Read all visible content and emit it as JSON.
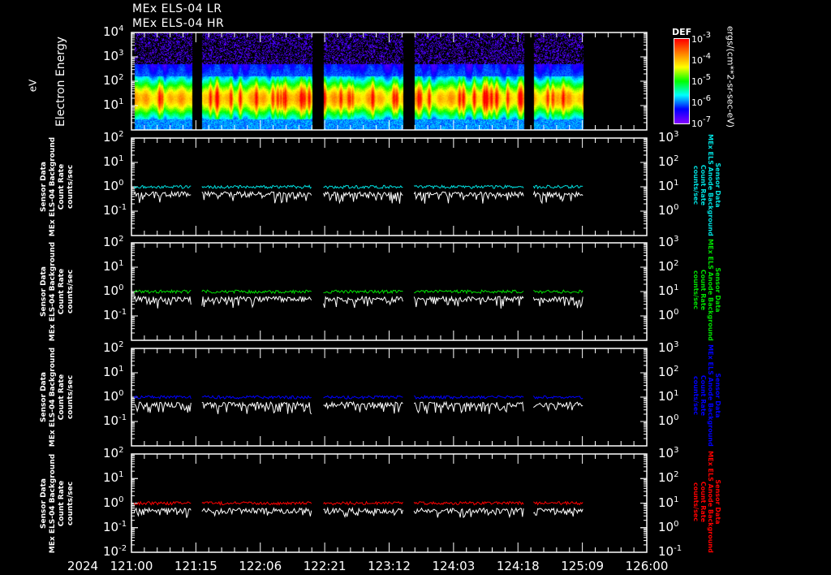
{
  "titles": [
    "MEx ELS-04 LR",
    "MEx ELS-04 HR"
  ],
  "x_axis": {
    "year": "2024",
    "tick_labels": [
      "121:00",
      "121:15",
      "122:06",
      "122:21",
      "123:12",
      "124:03",
      "124:18",
      "125:09",
      "126:00"
    ]
  },
  "colorbar": {
    "title": "DEF",
    "unit_label": "ergs/(cm**2-sr-sec-eV)",
    "tick_exponents": [
      "-3",
      "-4",
      "-5",
      "-6",
      "-7"
    ],
    "colors": [
      "#ff0000",
      "#ff8000",
      "#ffff00",
      "#00ff00",
      "#00ffff",
      "#0000ff",
      "#8000ff"
    ]
  },
  "chart_data": [
    {
      "type": "heatmap",
      "title": "MEx ELS-04 LR / HR",
      "ylabel": "Electron Energy",
      "yunit": "eV",
      "yscale": "log",
      "ylim_exponents": [
        0,
        4
      ],
      "ytick_exponents": [
        "4",
        "3",
        "2",
        "1"
      ],
      "xlim_hours": [
        0,
        120
      ],
      "data_segments_hours": [
        [
          0.6,
          14.0
        ],
        [
          16.4,
          42.1
        ],
        [
          44.7,
          63.2
        ],
        [
          65.8,
          91.3
        ],
        [
          93.6,
          105.1
        ]
      ],
      "peak_energy_eV": 20,
      "upper_cutoff_eV": 500
    },
    {
      "type": "line",
      "left_label": [
        "Sensor Data",
        "MEx ELS-04 Background",
        "Count Rate",
        "counts/sec"
      ],
      "right_label": [
        "Sensor Data",
        "MEx ELS Anode Background",
        "Count Rate",
        "counts/sec"
      ],
      "left_ytick_exponents": [
        "2",
        "1",
        "0",
        "-1"
      ],
      "right_ytick_exponents": [
        "3",
        "2",
        "1",
        "0"
      ],
      "yscale": "log",
      "series": [
        {
          "name": "ELS-04 background",
          "color": "#ffffff",
          "typical": 0.5,
          "min": 0.2
        },
        {
          "name": "Anode background",
          "color": "#00e0e0",
          "typical": 1.0,
          "min": 0.8
        }
      ]
    },
    {
      "type": "line",
      "left_label": [
        "Sensor Data",
        "MEx ELS-04 Background",
        "Count Rate",
        "counts/sec"
      ],
      "right_label": [
        "Sensor Data",
        "MEx ELS Anode Background",
        "Count Rate",
        "counts/sec"
      ],
      "left_ytick_exponents": [
        "2",
        "1",
        "0",
        "-1"
      ],
      "right_ytick_exponents": [
        "3",
        "2",
        "1",
        "0"
      ],
      "yscale": "log",
      "series": [
        {
          "name": "ELS-04 background",
          "color": "#ffffff",
          "typical": 0.5,
          "min": 0.2
        },
        {
          "name": "Anode background",
          "color": "#00e000",
          "typical": 1.0,
          "min": 0.8
        }
      ]
    },
    {
      "type": "line",
      "left_label": [
        "Sensor Data",
        "MEx ELS-04 Background",
        "Count Rate",
        "counts/sec"
      ],
      "right_label": [
        "Sensor Data",
        "MEx ELS Anode Background",
        "Count Rate",
        "counts/sec"
      ],
      "left_ytick_exponents": [
        "2",
        "1",
        "0",
        "-1"
      ],
      "right_ytick_exponents": [
        "3",
        "2",
        "1",
        "0"
      ],
      "yscale": "log",
      "series": [
        {
          "name": "ELS-04 background",
          "color": "#ffffff",
          "typical": 0.5,
          "min": 0.2
        },
        {
          "name": "Anode background",
          "color": "#0000ff",
          "typical": 1.0,
          "min": 0.8
        }
      ]
    },
    {
      "type": "line",
      "left_label": [
        "Sensor Data",
        "MEx ELS-04 Background",
        "Count Rate",
        "counts/sec"
      ],
      "right_label": [
        "Sensor Data",
        "MEx ELS Anode Background",
        "Count Rate",
        "counts/sec"
      ],
      "left_ytick_exponents": [
        "2",
        "1",
        "0",
        "-1",
        "-2"
      ],
      "right_ytick_exponents": [
        "3",
        "2",
        "1",
        "0",
        "-1"
      ],
      "yscale": "log",
      "series": [
        {
          "name": "ELS-04 background",
          "color": "#ffffff",
          "typical": 0.5,
          "min": 0.25
        },
        {
          "name": "Anode background",
          "color": "#ff0000",
          "typical": 1.0,
          "min": 0.9
        }
      ]
    }
  ]
}
